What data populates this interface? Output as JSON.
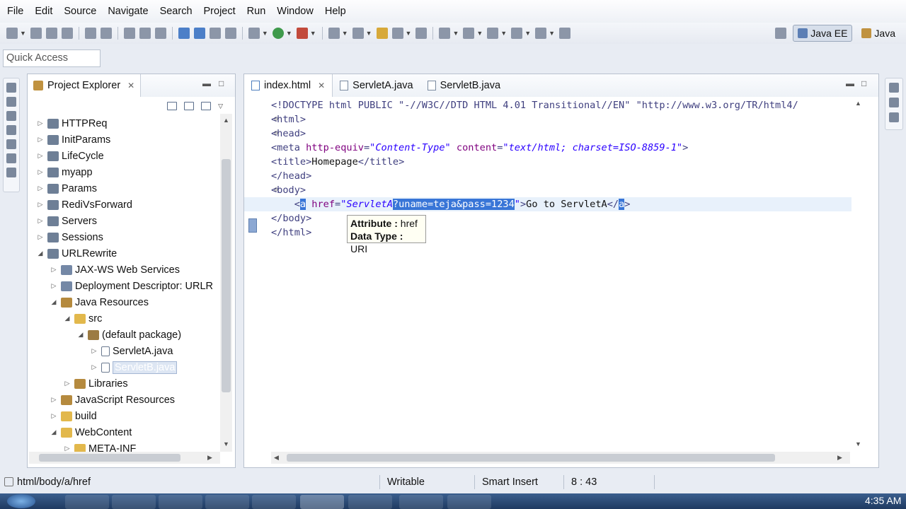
{
  "menu": [
    "File",
    "Edit",
    "Source",
    "Navigate",
    "Search",
    "Project",
    "Run",
    "Window",
    "Help"
  ],
  "quick_access": {
    "placeholder": "Quick Access"
  },
  "perspectives": [
    {
      "label": "Java EE",
      "active": true,
      "icon": "javaee-perspective-icon"
    },
    {
      "label": "Java",
      "active": false,
      "icon": "java-perspective-icon"
    }
  ],
  "explorer": {
    "title": "Project Explorer",
    "tree": [
      {
        "label": "HTTPReq",
        "depth": 0,
        "expanded": false,
        "icon": "project"
      },
      {
        "label": "InitParams",
        "depth": 0,
        "expanded": false,
        "icon": "project"
      },
      {
        "label": "LifeCycle",
        "depth": 0,
        "expanded": false,
        "icon": "project"
      },
      {
        "label": "myapp",
        "depth": 0,
        "expanded": false,
        "icon": "project"
      },
      {
        "label": "Params",
        "depth": 0,
        "expanded": false,
        "icon": "project"
      },
      {
        "label": "RediVsForward",
        "depth": 0,
        "expanded": false,
        "icon": "project"
      },
      {
        "label": "Servers",
        "depth": 0,
        "expanded": false,
        "icon": "project"
      },
      {
        "label": "Sessions",
        "depth": 0,
        "expanded": false,
        "icon": "project"
      },
      {
        "label": "URLRewrite",
        "depth": 0,
        "expanded": true,
        "icon": "project"
      },
      {
        "label": "JAX-WS Web Services",
        "depth": 1,
        "expanded": false,
        "icon": "ws"
      },
      {
        "label": "Deployment Descriptor: URLR",
        "depth": 1,
        "expanded": false,
        "icon": "ws"
      },
      {
        "label": "Java Resources",
        "depth": 1,
        "expanded": true,
        "icon": "jar"
      },
      {
        "label": "src",
        "depth": 2,
        "expanded": true,
        "icon": "folder"
      },
      {
        "label": "(default package)",
        "depth": 3,
        "expanded": true,
        "icon": "pkg"
      },
      {
        "label": "ServletA.java",
        "depth": 4,
        "expanded": false,
        "icon": "java"
      },
      {
        "label": "ServletB.java",
        "depth": 4,
        "expanded": false,
        "icon": "java",
        "selected": true
      },
      {
        "label": "Libraries",
        "depth": 2,
        "expanded": false,
        "icon": "jar"
      },
      {
        "label": "JavaScript Resources",
        "depth": 1,
        "expanded": false,
        "icon": "jar"
      },
      {
        "label": "build",
        "depth": 1,
        "expanded": false,
        "icon": "folder"
      },
      {
        "label": "WebContent",
        "depth": 1,
        "expanded": true,
        "icon": "folder"
      },
      {
        "label": "META-INF",
        "depth": 2,
        "expanded": false,
        "icon": "folder"
      }
    ]
  },
  "editor": {
    "tabs": [
      {
        "label": "index.html",
        "active": true
      },
      {
        "label": "ServletA.java",
        "active": false
      },
      {
        "label": "ServletB.java",
        "active": false
      }
    ],
    "lines": [
      {
        "fold": "",
        "parts": [
          [
            "tag",
            "<!DOCTYPE html PUBLIC \"-//W3C//DTD HTML 4.01 Transitional//EN\" \"http://www.w3.org/TR/html4/"
          ]
        ]
      },
      {
        "fold": "⊖",
        "parts": [
          [
            "tag",
            "<html>"
          ]
        ]
      },
      {
        "fold": "⊖",
        "parts": [
          [
            "tag",
            "<head>"
          ]
        ]
      },
      {
        "fold": "",
        "parts": [
          [
            "tag",
            "<meta "
          ],
          [
            "attn",
            "http-equiv"
          ],
          [
            "tag",
            "="
          ],
          [
            "attv",
            "\"Content-Type\""
          ],
          [
            "tag",
            " "
          ],
          [
            "attn",
            "content"
          ],
          [
            "tag",
            "="
          ],
          [
            "attv",
            "\"text/html; charset=ISO-8859-1\""
          ],
          [
            "tag",
            ">"
          ]
        ]
      },
      {
        "fold": "",
        "parts": [
          [
            "tag",
            "<title>"
          ],
          [
            "txtc",
            "Homepage"
          ],
          [
            "tag",
            "</title>"
          ]
        ]
      },
      {
        "fold": "",
        "parts": [
          [
            "tag",
            "</head>"
          ]
        ]
      },
      {
        "fold": "⊖",
        "parts": [
          [
            "tag",
            "<body>"
          ]
        ]
      },
      {
        "fold": "",
        "current": true,
        "parts": [
          [
            "tag",
            "    <"
          ],
          [
            "sel",
            "a"
          ],
          [
            "tag",
            " "
          ],
          [
            "attn",
            "href"
          ],
          [
            "tag",
            "="
          ],
          [
            "attv",
            "\"ServletA"
          ],
          [
            "sel",
            "?uname=teja&pass=1234"
          ],
          [
            "attv",
            "\""
          ],
          [
            "tag",
            ">"
          ],
          [
            "txtc",
            "Go to ServletA"
          ],
          [
            "tag",
            "</"
          ],
          [
            "sel",
            "a"
          ],
          [
            "tag",
            ">"
          ]
        ]
      },
      {
        "fold": "",
        "parts": [
          [
            "tag",
            "</body>"
          ]
        ]
      },
      {
        "fold": "",
        "parts": [
          [
            "tag",
            "</html>"
          ]
        ]
      }
    ],
    "tooltip": {
      "attr_label": "Attribute :",
      "attr_value": "href",
      "type_label": "Data Type :",
      "type_value": "URI"
    }
  },
  "status": {
    "path": "html/body/a/href",
    "mode": "Writable",
    "insert": "Smart Insert",
    "position": "8 : 43"
  },
  "taskbar": {
    "clock": "4:35 AM"
  }
}
